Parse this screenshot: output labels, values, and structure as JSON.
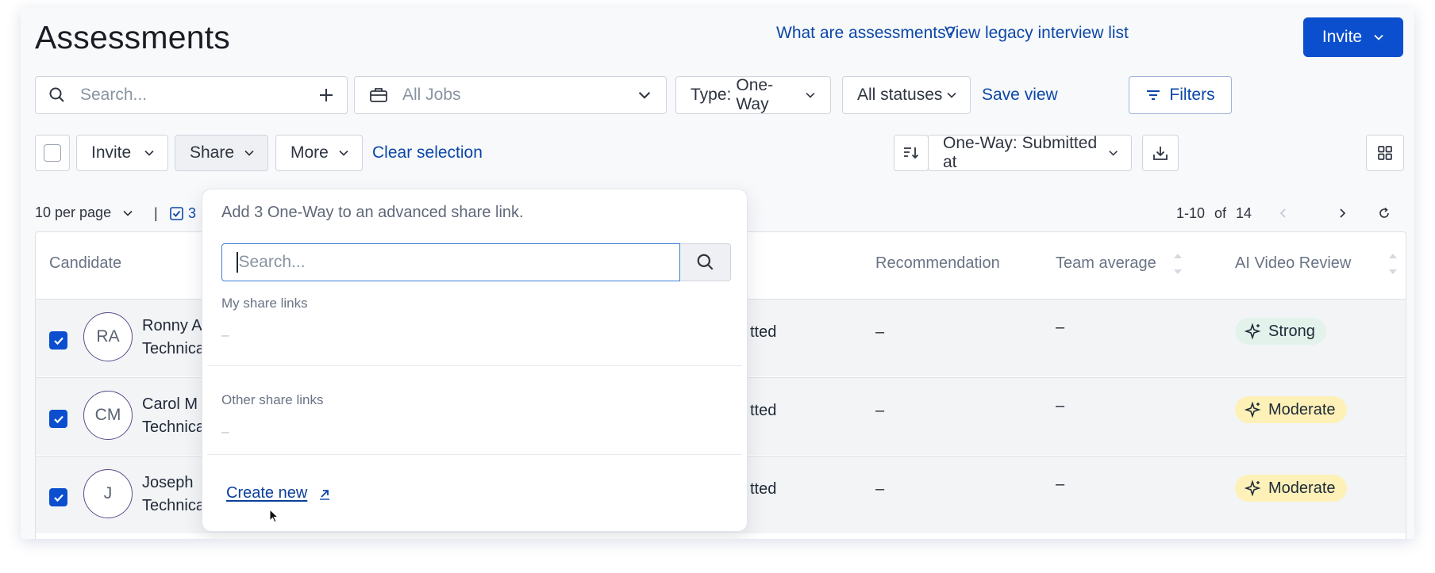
{
  "page": {
    "title": "Assessments"
  },
  "header": {
    "what_are_link": "What are assessments?",
    "legacy_link": "View legacy interview list",
    "invite_button": "Invite"
  },
  "filters": {
    "search_placeholder": "Search...",
    "jobs_placeholder": "All Jobs",
    "type_prefix": "Type:",
    "type_value": "One-Way",
    "status_value": "All statuses",
    "save_view": "Save view",
    "filters_button": "Filters"
  },
  "actions": {
    "invite": "Invite",
    "share": "Share",
    "more": "More",
    "clear_selection": "Clear selection",
    "sort_value": "One-Way: Submitted at"
  },
  "pagination": {
    "per_page": "10 per page",
    "separator": "|",
    "selected_count": "3",
    "range": "1-10",
    "of_label": "of",
    "total": "14"
  },
  "table": {
    "columns": {
      "candidate": "Candidate",
      "recommendation": "Recommendation",
      "team_average": "Team average",
      "ai_review": "AI Video Review"
    },
    "rows": [
      {
        "initials": "RA",
        "name": "Ronny A",
        "role": "Technica",
        "status": "tted",
        "recommendation": "–",
        "team_average": "–",
        "ai_review": "Strong"
      },
      {
        "initials": "CM",
        "name": "Carol M",
        "role": "Technica",
        "status": "tted",
        "recommendation": "–",
        "team_average": "–",
        "ai_review": "Moderate"
      },
      {
        "initials": "J",
        "name": "Joseph",
        "role": "Technica",
        "status": "tted",
        "recommendation": "–",
        "team_average": "–",
        "ai_review": "Moderate"
      }
    ]
  },
  "share_dropdown": {
    "heading": "Add 3 One-Way to an advanced share link.",
    "search_placeholder": "Search...",
    "my_links_label": "My share links",
    "my_links_empty": "–",
    "other_links_label": "Other share links",
    "other_links_empty": "–",
    "create_new": "Create new"
  },
  "colors": {
    "primary": "#0b4fcf",
    "link": "#0b47a8",
    "strong_badge": "#e3f3ec",
    "moderate_badge": "#fdf1b8"
  }
}
